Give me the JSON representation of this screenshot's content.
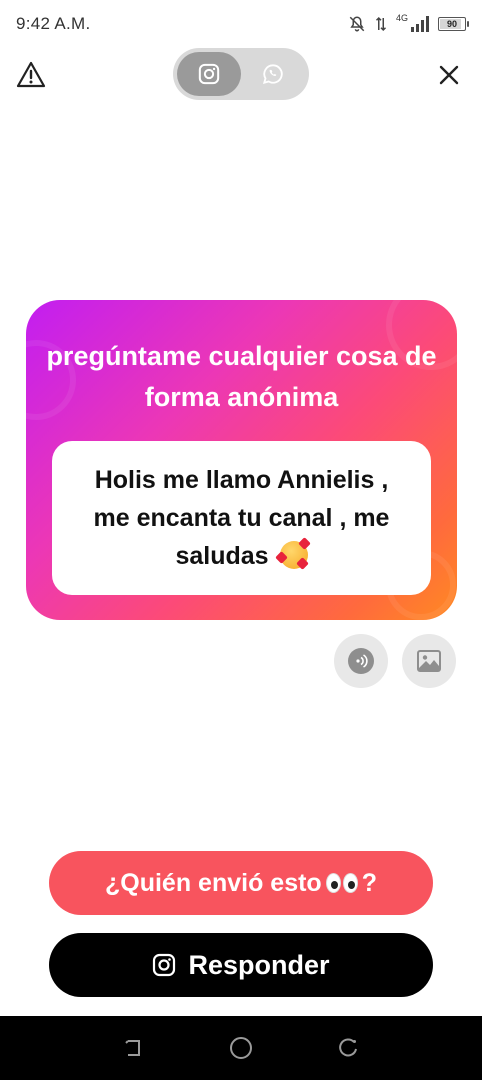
{
  "status_bar": {
    "time": "9:42 A.M.",
    "network": "4G",
    "battery": "90"
  },
  "top_bar": {
    "platforms": [
      {
        "name": "instagram",
        "icon": "instagram-icon",
        "active": true
      },
      {
        "name": "whatsapp",
        "icon": "whatsapp-icon",
        "active": false
      }
    ]
  },
  "card": {
    "title": "pregúntame cualquier cosa de forma anónima",
    "message": "Holis me llamo Annielis , me encanta tu canal , me saludas",
    "message_emoji": "smiling-face-with-hearts",
    "gradient": [
      "#c21ef1",
      "#fc4a78",
      "#ff8a22"
    ]
  },
  "actions": {
    "audio_icon": "sound-icon",
    "image_icon": "image-icon"
  },
  "buttons": {
    "who_sent_pre": "¿Quién envió esto",
    "who_sent_post": "?",
    "reply": "Responder"
  },
  "colors": {
    "who_button": "#f8545e",
    "reply_button": "#000000"
  }
}
